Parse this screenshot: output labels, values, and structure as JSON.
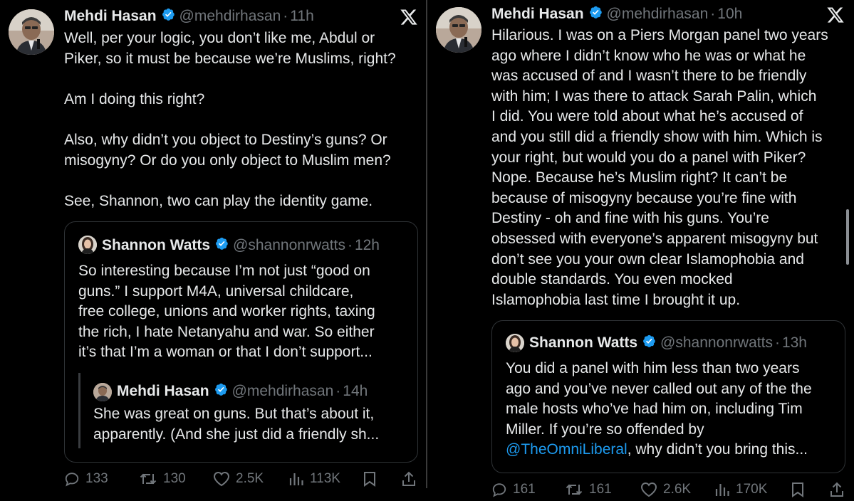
{
  "left_tweet": {
    "author_name": "Mehdi Hasan",
    "handle": "@mehdirhasan",
    "time": "11h",
    "separator": "·",
    "text": "Well, per your logic, you don’t like me, Abdul or\nPiker, so it must be because we’re Muslims, right?\n\nAm I doing this right?\n\nAlso, why didn’t you object to Destiny’s guns? Or\nmisogyny? Or do you only object to Muslim men?\n\nSee, Shannon, two can play the identity game.",
    "quote": {
      "author_name": "Shannon Watts",
      "handle": "@shannonrwatts",
      "time": "12h",
      "separator": "·",
      "text": "So interesting because I’m not just “good on\nguns.” I support M4A, universal childcare,\nfree college, unions and worker rights, taxing\nthe rich, I hate Netanyahu and war. So either\nit’s that I’m a woman or that I don’t support...",
      "nested": {
        "author_name": "Mehdi Hasan",
        "handle": "@mehdirhasan",
        "time": "14h",
        "separator": "·",
        "text": "She was great on guns. But that’s about it,\napparently. (And she just did a friendly sh..."
      }
    },
    "actions": {
      "replies": "133",
      "reposts": "130",
      "likes": "2.5K",
      "views": "113K"
    }
  },
  "right_tweet": {
    "author_name": "Mehdi Hasan",
    "handle": "@mehdirhasan",
    "time": "10h",
    "separator": "·",
    "text": "Hilarious. I was on a Piers Morgan panel two years\nago where I didn’t know who he was or what he\nwas accused of and I wasn’t there to be friendly\nwith him; I was there to attack Sarah Palin, which\nI did. You were told about what he’s accused of\nand you still did a friendly show with him. Which is\nyour right, but would you do a panel with Piker?\nNope. Because he’s Muslim right? It can’t be\nbecause of misogyny because you’re fine with\nDestiny - oh and fine with his guns. You’re\nobsessed with everyone’s apparent misogyny but\ndon’t see you your own clear Islamophobia and\ndouble standards. You even mocked\nIslamophobia last time I brought it up.",
    "quote": {
      "author_name": "Shannon Watts",
      "handle": "@shannonrwatts",
      "time": "13h",
      "separator": "·",
      "text": "You did a panel with him less than two years\nago and you’ve never called out any of the the\nmale hosts who’ve had him on, including Tim\nMiller. If you’re so offended by",
      "mention": "@TheOmniLiberal",
      "text_after_mention": ", why didn’t you bring this..."
    },
    "actions": {
      "replies": "161",
      "reposts": "161",
      "likes": "2.6K",
      "views": "170K"
    }
  },
  "colors": {
    "background": "#000000",
    "text": "#e7e9ea",
    "muted": "#71767b",
    "verified": "#1d9bf0",
    "link": "#1d9bf0",
    "border": "#2f3336"
  },
  "icons": [
    "x-logo-icon",
    "verified-badge-icon",
    "reply-icon",
    "repost-icon",
    "like-icon",
    "views-icon",
    "bookmark-icon",
    "share-icon"
  ]
}
